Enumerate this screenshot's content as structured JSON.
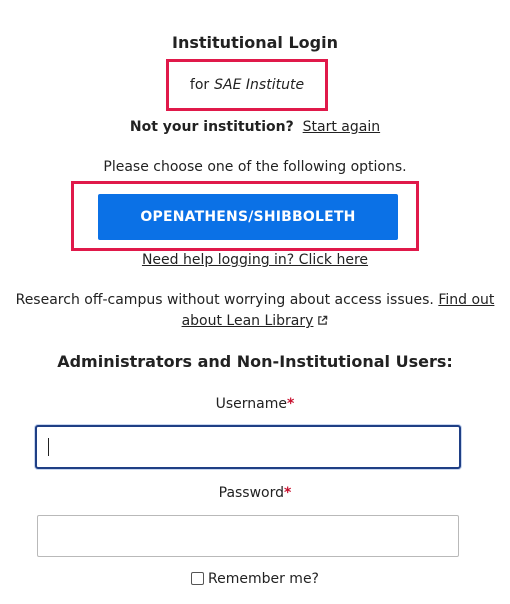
{
  "header": {
    "title": "Institutional Login",
    "institution_prefix": "for",
    "institution_name": "SAE Institute"
  },
  "not_institution": {
    "question": "Not your institution?",
    "start_again_link": "Start again"
  },
  "options": {
    "prompt": "Please choose one of the following options.",
    "openathens_button": "OPENATHENS/SHIBBOLETH",
    "help_link": "Need help logging in? Click here"
  },
  "research": {
    "text": "Research off-campus without worrying about access issues.",
    "link": "Find out about Lean Library",
    "link_icon": "external-link-icon"
  },
  "admin": {
    "heading": "Administrators and Non-Institutional Users:",
    "username_label": "Username",
    "username_value": "",
    "password_label": "Password",
    "password_value": "",
    "required_marker": "*",
    "remember_label": "Remember me?",
    "remember_checked": false
  },
  "colors": {
    "button_blue": "#0b71e6",
    "highlight_red": "#e0194a",
    "required_red": "#c8102e",
    "focus_border": "#1f3f85"
  }
}
